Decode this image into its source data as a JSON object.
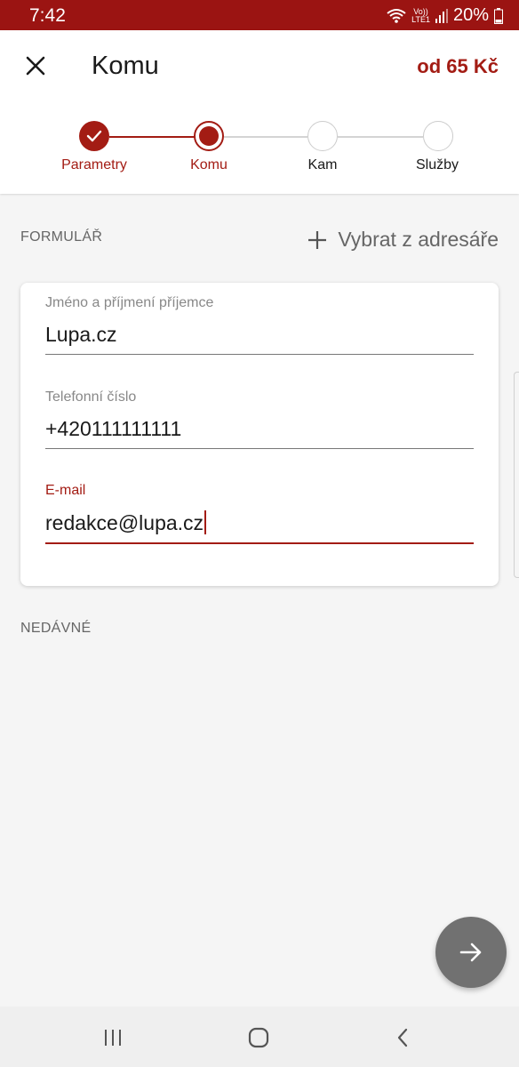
{
  "status_bar": {
    "time": "7:42",
    "network_top": "Vo))",
    "network_bottom": "LTE1",
    "battery": "20%"
  },
  "app_bar": {
    "title": "Komu",
    "price": "od 65 Kč"
  },
  "stepper": {
    "steps": [
      {
        "label": "Parametry",
        "state": "done"
      },
      {
        "label": "Komu",
        "state": "current"
      },
      {
        "label": "Kam",
        "state": "pending"
      },
      {
        "label": "Služby",
        "state": "pending"
      }
    ]
  },
  "form": {
    "section_title": "FORMULÁŘ",
    "pick_contact_label": "Vybrat z adresáře",
    "fields": [
      {
        "label": "Jméno a příjmení příjemce",
        "value": "Lupa.cz"
      },
      {
        "label": "Telefonní číslo",
        "value": "+420111111111"
      },
      {
        "label": "E-mail",
        "value": "redakce@lupa.cz"
      }
    ]
  },
  "recent": {
    "section_title": "NEDÁVNÉ"
  },
  "colors": {
    "accent": "#a31c14",
    "status_bar": "#9b1412",
    "fab": "#717171"
  },
  "icons": {
    "close": "close-icon",
    "add": "plus-icon",
    "next": "arrow-right-icon"
  }
}
